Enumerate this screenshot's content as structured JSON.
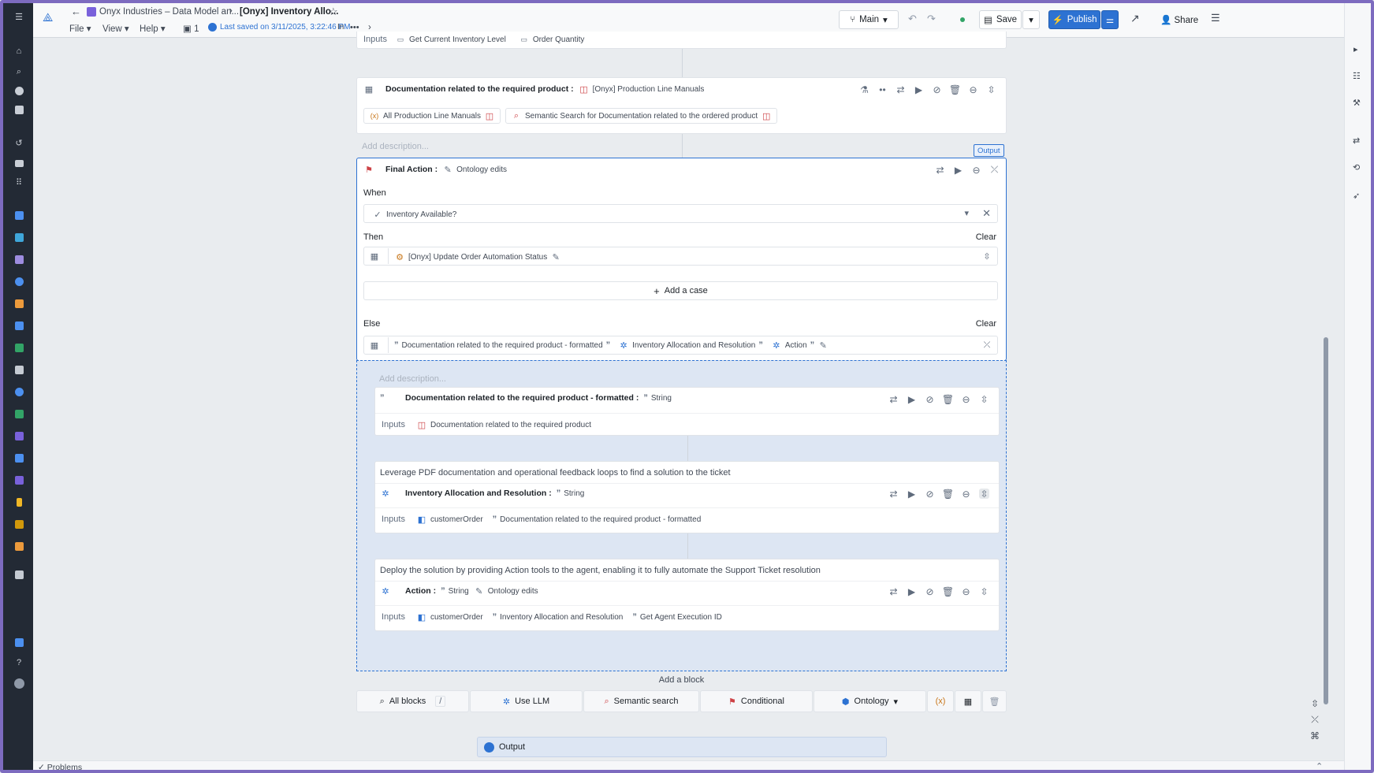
{
  "header": {
    "breadcrumb_1": "Onyx Industries – Data Model an...",
    "breadcrumb_2": "[Onyx] Inventory Allo...",
    "menu_file": "File",
    "menu_view": "View",
    "menu_help": "Help",
    "page_count": "1",
    "last_saved": "Last saved on 3/11/2025, 3:22:46 PM",
    "in_label": "In",
    "branch": "Main",
    "save": "Save",
    "publish": "Publish",
    "share": "Share"
  },
  "top_inputs": {
    "label": "Inputs",
    "items": [
      "Get Current Inventory Level",
      "Order Quantity"
    ]
  },
  "doc_block": {
    "title": "Documentation related to the required product",
    "type": "[Onyx] Production Line Manuals",
    "chip1": "All Production Line Manuals",
    "chip2": "Semantic Search for Documentation related to the ordered product",
    "add_description": "Add description..."
  },
  "output_tag": "Output",
  "final_action": {
    "title": "Final Action",
    "type": "Ontology edits",
    "when_label": "When",
    "when_value": "Inventory Available?",
    "then_label": "Then",
    "clear": "Clear",
    "then_value": "[Onyx] Update Order Automation Status",
    "add_case": "Add a case",
    "else_label": "Else",
    "else_items": [
      "Documentation related to the required product - formatted",
      "Inventory Allocation and Resolution",
      "Action"
    ]
  },
  "nested": {
    "add_description": "Add description...",
    "blocks": [
      {
        "description": "",
        "title": "Documentation related to the required product - formatted",
        "type": "String",
        "types2": "",
        "inputs_label": "Inputs",
        "inputs": [
          "Documentation related to the required product"
        ]
      },
      {
        "description": "Leverage PDF documentation and operational feedback loops to find a solution to the ticket",
        "title": "Inventory Allocation and Resolution",
        "type": "String",
        "types2": "",
        "inputs_label": "Inputs",
        "inputs": [
          "customerOrder",
          "Documentation related to the required product - formatted"
        ]
      },
      {
        "description": "Deploy the solution by providing Action tools to the agent, enabling it to fully automate the Support Ticket resolution",
        "title": "Action",
        "type": "String",
        "types2": "Ontology edits",
        "inputs_label": "Inputs",
        "inputs": [
          "customerOrder",
          "Inventory Allocation and Resolution",
          "Get Agent Execution ID"
        ]
      }
    ]
  },
  "add_block": "Add a block",
  "toolbar": {
    "all_blocks": "All blocks",
    "shortcut": "/",
    "use_llm": "Use LLM",
    "semantic": "Semantic search",
    "conditional": "Conditional",
    "ontology": "Ontology"
  },
  "output_bar": "Output",
  "status": {
    "problems": "Problems"
  }
}
